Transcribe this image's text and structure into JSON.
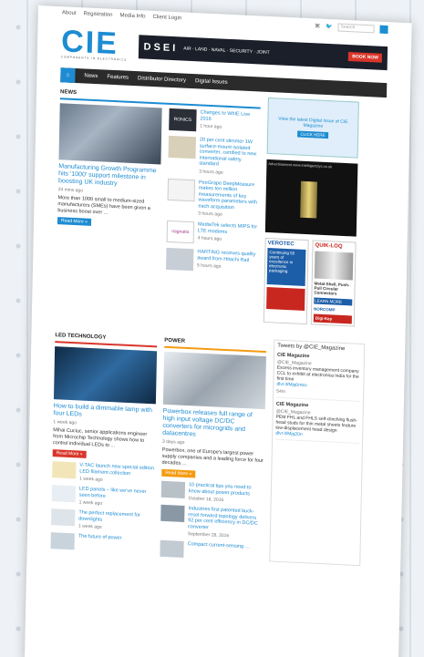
{
  "topbar": {
    "links": [
      "About",
      "Registration",
      "Media Info",
      "Client Login"
    ],
    "search_placeholder": "Search"
  },
  "logo": {
    "title": "CIE",
    "subtitle": "COMPONENTS IN ELECTRONICS"
  },
  "banner": {
    "brand": "DSEI",
    "tagline": "AIR · LAND · NAVAL · SECURITY · JOINT",
    "cta": "BOOK NOW"
  },
  "nav": {
    "items": [
      "News",
      "Features",
      "Distributor Directory",
      "Digital Issues"
    ]
  },
  "news": {
    "label": "NEWS",
    "feature": {
      "headline": "Manufacturing Growth Programme hits '1000' support milestone in boosting UK industry",
      "time": "24 mins ago",
      "excerpt": "More than 1000 small to medium-sized manufacturers (SMEs) have been given a business boost over ...",
      "read_more": "Read More »"
    },
    "side": [
      {
        "headline": "Changes to WhIE Live 2016",
        "time": "1 hour ago",
        "thumb": "RONICS"
      },
      {
        "headline": "20 per cent slimmer 1W surface-mount isolated converter, certified to new international safety standard",
        "time": "3 hours ago"
      },
      {
        "headline": "PeoGrape DeepMeasure makes ten million measurements of key waveform parameters with each acquisition",
        "time": "3 hours ago"
      },
      {
        "headline": "MediaTek selects MIPS for LTE modems",
        "time": "4 hours ago",
        "thumb": "nagnatio"
      },
      {
        "headline": "HARTING receives quality award from Hitachi Rail",
        "time": "5 hours ago"
      }
    ]
  },
  "ads": {
    "cie": {
      "text": "View the latest Digital Issue of CIE Magazine",
      "cta": "CLICK HERE"
    },
    "video_label": "Advertisement  www.intelligentsys.co.uk",
    "verotec": "VEROTEC",
    "verotec_text": "Continuing 50 years of excellence in electronic packaging",
    "quickloq": "QUIK-LOQ",
    "quickloq_text": "Metal-Shell, Push-Pull Circular Connectors",
    "learn_more": "LEARN MORE",
    "norcomp": "NORCOMP",
    "digikey": "Digi-Key"
  },
  "led": {
    "label": "LED TECHNOLOGY",
    "headline": "How to build a dimmable lamp with four LEDs",
    "time": "1 week ago",
    "excerpt": "Mihai Cuciuc, senior applications engineer from Microchip Technology shows how to control individual LEDs to ...",
    "read_more": "Read More »",
    "items": [
      {
        "title": "V-TAC launch new special edition LED filament collection",
        "time": "1 week ago"
      },
      {
        "title": "LED panels – like we've never seen before",
        "time": "1 week ago"
      },
      {
        "title": "The perfect replacement for downlights",
        "time": "1 week ago"
      },
      {
        "title": "The future of power",
        "time": ""
      }
    ]
  },
  "power": {
    "label": "POWER",
    "headline": "Powerbox releases full range of high input voltage DC/DC converters for microgrids and datacentres",
    "time": "3 days ago",
    "excerpt": "Powerbox, one of Europe's largest power supply companies and a leading force for four decades ...",
    "read_more": "Read More »",
    "items": [
      {
        "title": "10 practical tips you need to know about power products",
        "time": "October 18, 2016"
      },
      {
        "title": "Industries first patented buck-reset forward topology delivers 92 per cent efficiency in DC/DC converter",
        "time": "September 28, 2016"
      },
      {
        "title": "Compact current-sensing …",
        "time": ""
      }
    ]
  },
  "tweets": {
    "header": "Tweets by @CIE_Magazine",
    "items": [
      {
        "name": "CIE Magazine",
        "handle": "@CIE_Magazine",
        "text": "Excess inventory management company CCL to exhibit at electronica India for the first time",
        "link": "dlvr.it/Mjq0mkn",
        "time": "54m"
      },
      {
        "name": "CIE Magazine",
        "handle": "@CIE_Magazine",
        "text": "PEM FHL and FHLS self-clinching flush-head studs for thin metal sheets feature low-displacement head design",
        "link": "dlvr.it/Mjq20n",
        "time": ""
      }
    ]
  }
}
